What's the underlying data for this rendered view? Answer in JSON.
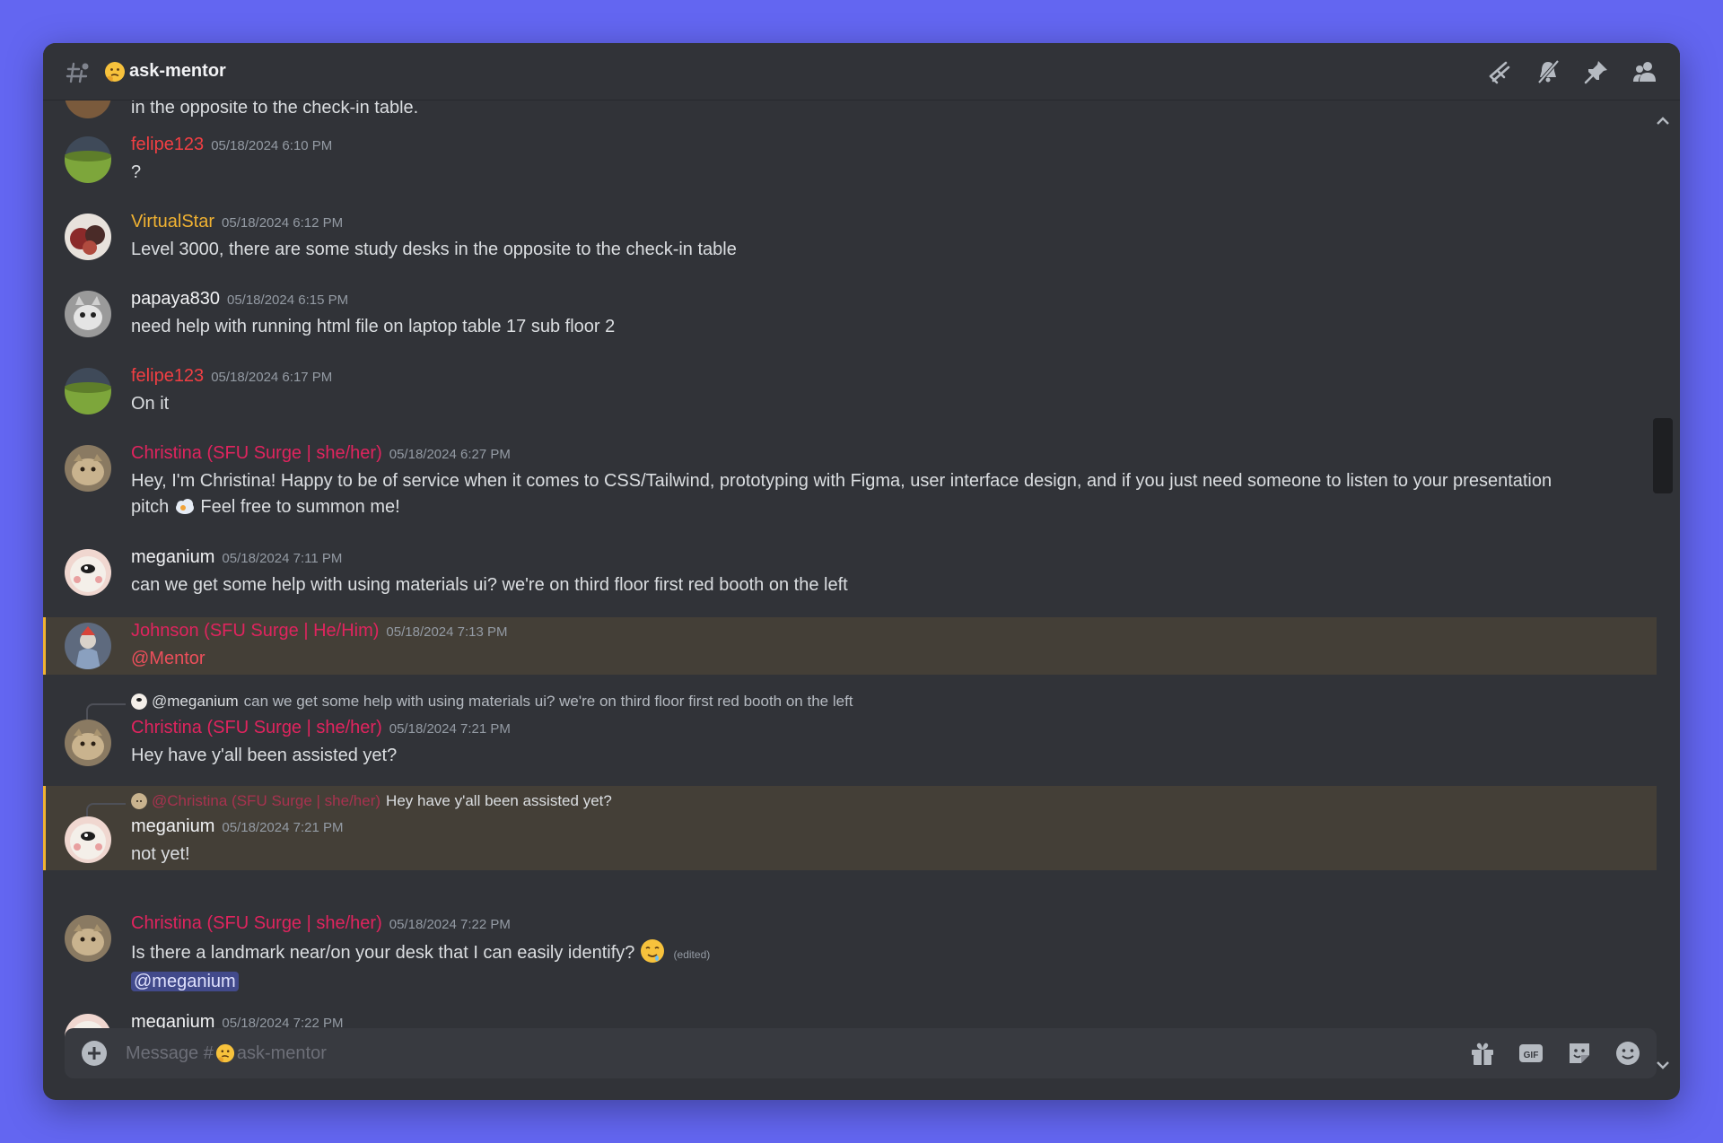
{
  "channel": {
    "name": "ask-mentor",
    "emoji": "thinking-face"
  },
  "header": {
    "tools": [
      "threads-icon",
      "notification-muted-icon",
      "pin-icon",
      "members-icon"
    ]
  },
  "cutoff_top": {
    "text": "in the opposite to the check-in table."
  },
  "messages": [
    {
      "author": "felipe123",
      "color": "#f23f43",
      "time": "05/18/2024 6:10 PM",
      "text": "?"
    },
    {
      "author": "VirtualStar",
      "color": "#f0b232",
      "time": "05/18/2024 6:12 PM",
      "text": "Level 3000, there are some study desks in the opposite to the check-in table"
    },
    {
      "author": "papaya830",
      "color": "#f2f3f5",
      "time": "05/18/2024 6:15 PM",
      "text": "need help with running html file on laptop table 17 sub floor 2"
    },
    {
      "author": "felipe123",
      "color": "#f23f43",
      "time": "05/18/2024 6:17 PM",
      "text": "On it"
    },
    {
      "author": "Christina (SFU Surge | she/her)",
      "color": "#e0245e",
      "time": "05/18/2024 6:27 PM",
      "text_line1": "Hey, I'm Christina! Happy to be of service when it comes to CSS/Tailwind, prototyping with Figma, user interface design, and if you just need someone to listen to your presentation",
      "text_line2_pre": "pitch",
      "text_line2_post": "Feel free to summon me!"
    },
    {
      "author": "meganium",
      "color": "#f2f3f5",
      "time": "05/18/2024 7:11 PM",
      "text": "can we get some help with using materials ui? we're on third floor first red booth on the left"
    },
    {
      "author": "Johnson (SFU Surge | He/Him)",
      "color": "#e0245e",
      "time": "05/18/2024 7:13 PM",
      "text": "@Mentor"
    },
    {
      "reply_user": "@meganium",
      "reply_text": "can we get some help with using materials ui? we're on third floor first red booth on the left",
      "author": "Christina (SFU Surge | she/her)",
      "color": "#e0245e",
      "time": "05/18/2024 7:21 PM",
      "text": "Hey have y'all been assisted yet?"
    },
    {
      "reply_user": "@Christina (SFU Surge | she/her)",
      "reply_text": "Hey have y'all been assisted yet?",
      "author": "meganium",
      "color": "#f2f3f5",
      "time": "05/18/2024 7:21 PM",
      "text": "not yet!"
    },
    {
      "author": "Christina (SFU Surge | she/her)",
      "color": "#e0245e",
      "time": "05/18/2024 7:22 PM",
      "text": "Is there a landmark near/on your desk that I can easily identify?",
      "edited": "(edited)",
      "mention": "@meganium"
    },
    {
      "author": "meganium",
      "color": "#f2f3f5",
      "time": "05/18/2024 7:22 PM"
    }
  ],
  "composer": {
    "placeholder_prefix": "Message #",
    "placeholder_channel": "ask-mentor",
    "tools": [
      "gift-icon",
      "gif-icon",
      "sticker-icon",
      "emoji-icon"
    ]
  }
}
